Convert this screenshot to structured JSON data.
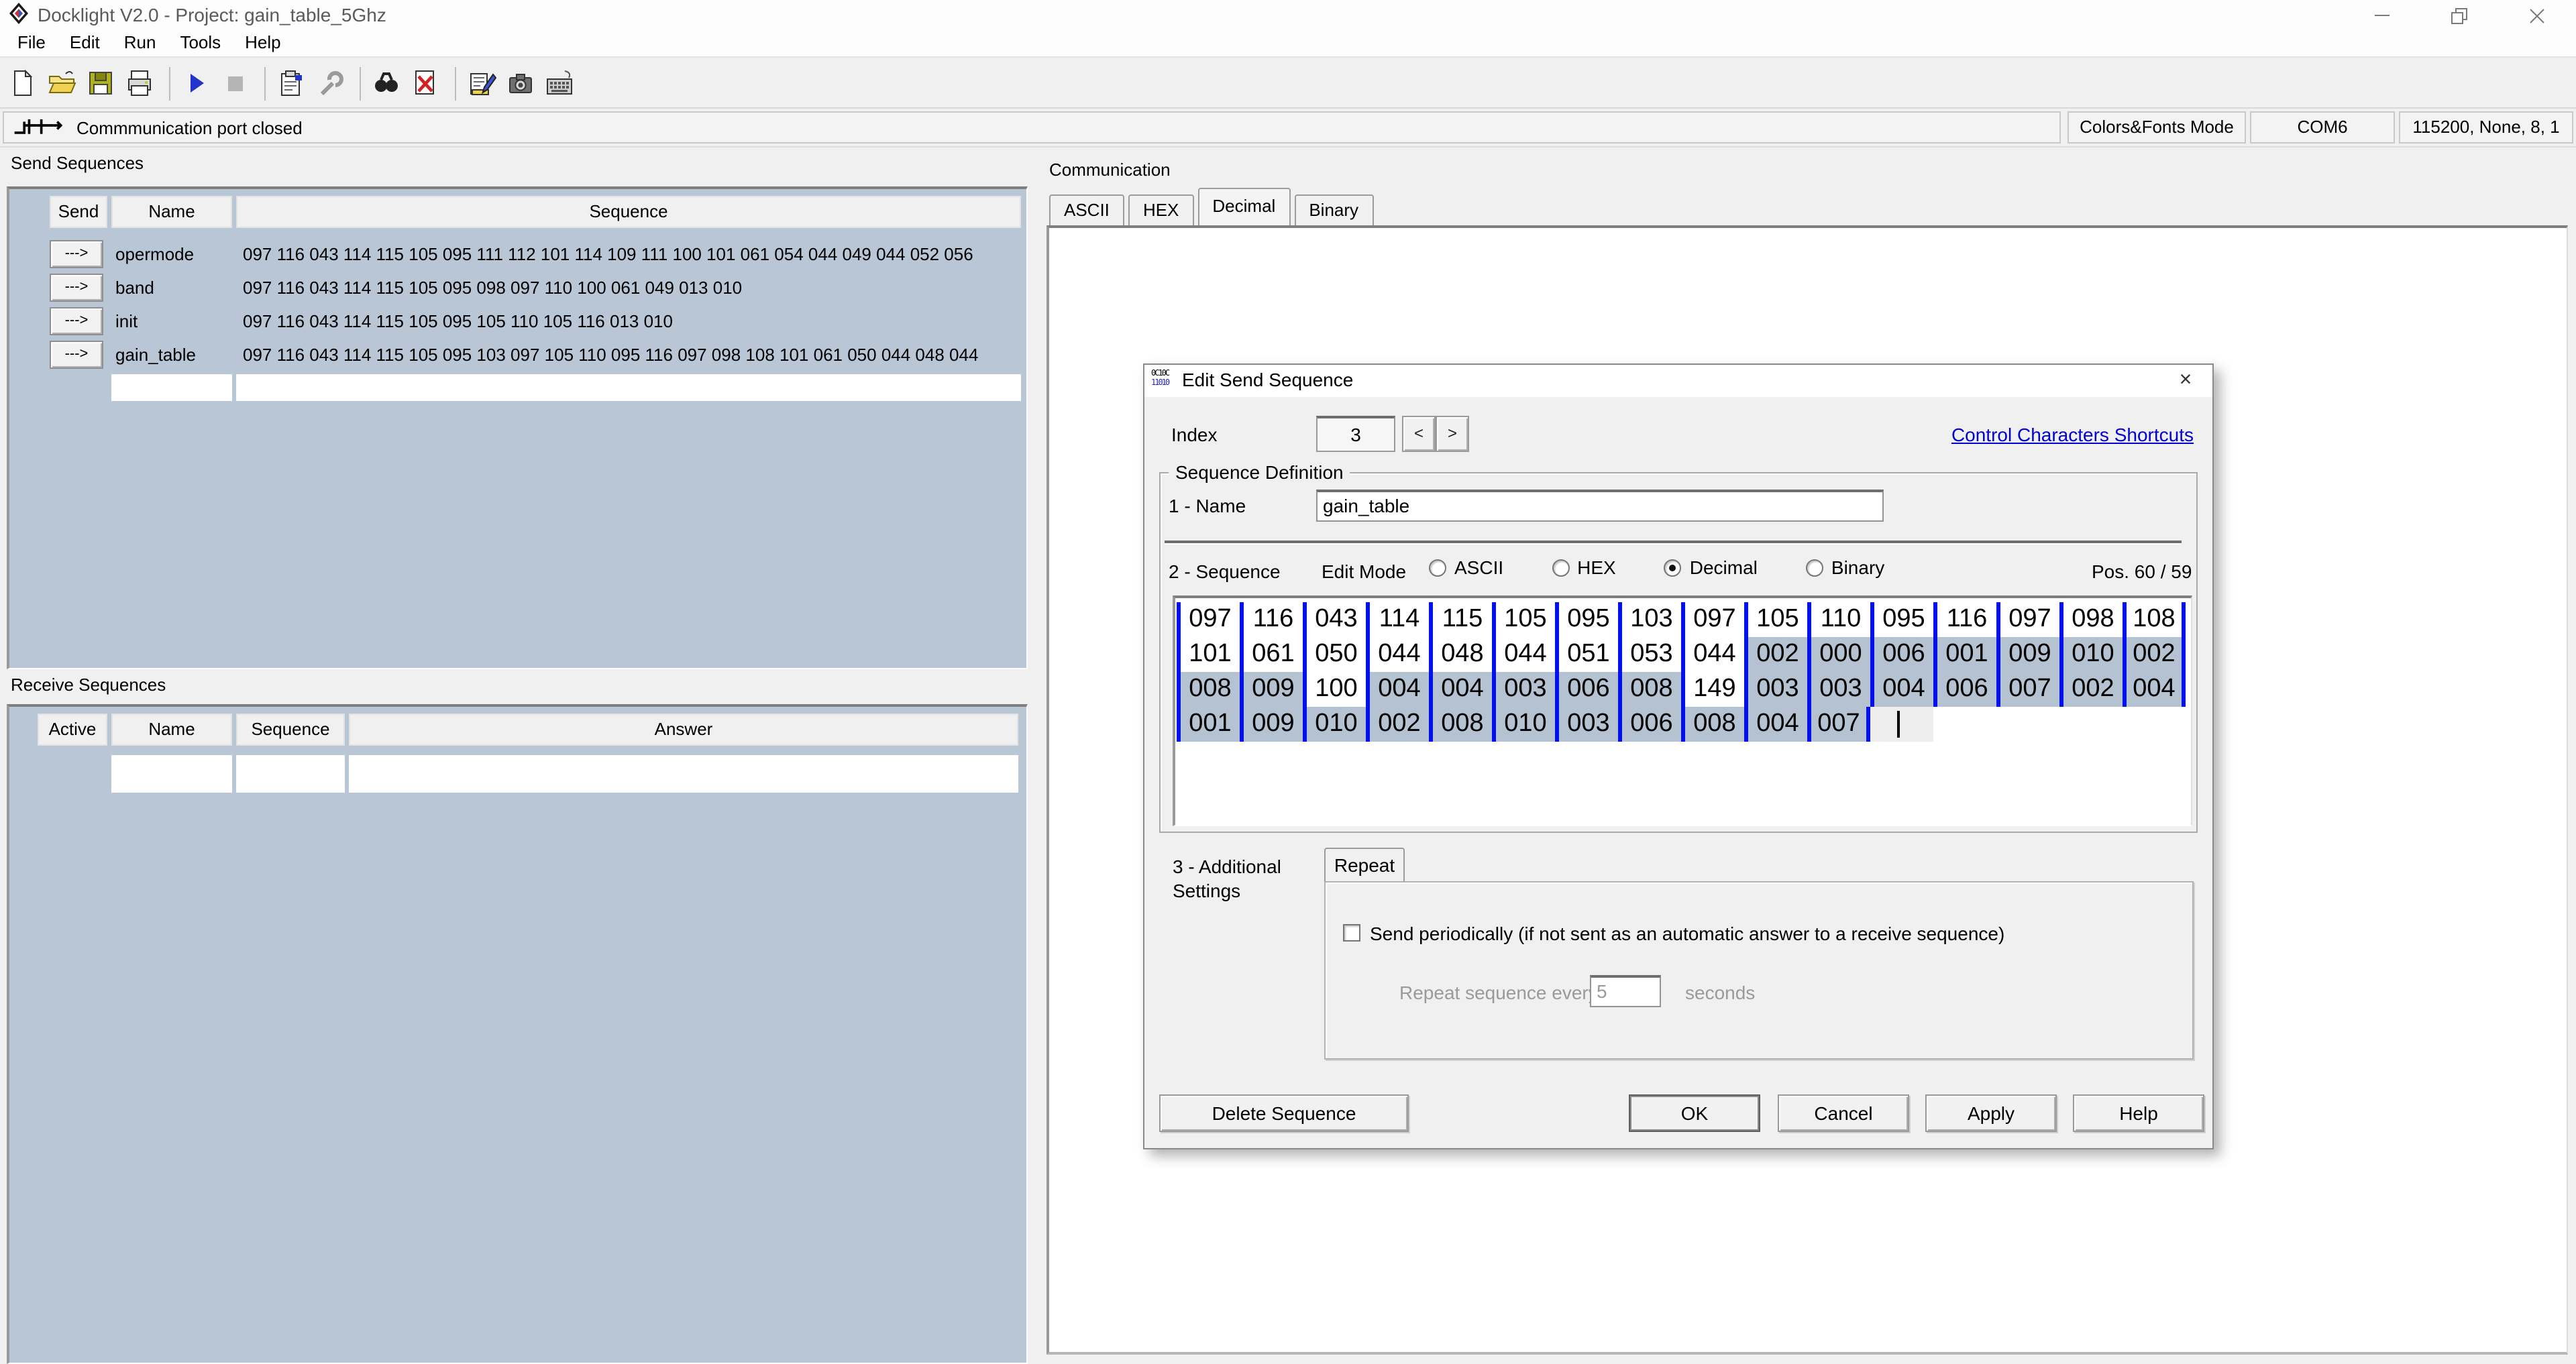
{
  "window": {
    "title": "Docklight V2.0 - Project: gain_table_5Ghz"
  },
  "menu": {
    "items": [
      "File",
      "Edit",
      "Run",
      "Tools",
      "Help"
    ]
  },
  "toolbar": {
    "groups": [
      [
        "new-file",
        "open-project",
        "save-project",
        "print"
      ],
      [
        "start-communication",
        "stop-communication"
      ],
      [
        "project-settings",
        "options-wrench"
      ],
      [
        "find",
        "clear-communication"
      ],
      [
        "edit-send-sequences",
        "snapshot-camera",
        "keyboard-console"
      ]
    ]
  },
  "status": {
    "message": "Commmunication port closed",
    "mode": "Colors&Fonts Mode",
    "port": "COM6",
    "params": "115200, None, 8, 1"
  },
  "send_sequences": {
    "title": "Send Sequences",
    "columns": [
      "Send",
      "Name",
      "Sequence"
    ],
    "send_button_label": "--->",
    "rows": [
      {
        "name": "opermode",
        "sequence": "097 116 043 114 115 105 095 111 112 101 114 109 111 100 101 061 054 044 049 044 052 056"
      },
      {
        "name": "band",
        "sequence": "097 116 043 114 115 105 095 098 097 110 100 061 049 013 010"
      },
      {
        "name": "init",
        "sequence": "097 116 043 114 115 105 095 105 110 105 116 013 010"
      },
      {
        "name": "gain_table",
        "sequence": "097 116 043 114 115 105 095 103 097 105 110 095 116 097 098 108 101 061 050 044 048 044"
      }
    ]
  },
  "receive_sequences": {
    "title": "Receive Sequences",
    "columns": [
      "Active",
      "Name",
      "Sequence",
      "Answer"
    ]
  },
  "communication": {
    "title": "Communication",
    "tabs": [
      "ASCII",
      "HEX",
      "Decimal",
      "Binary"
    ],
    "active_tab": "Decimal"
  },
  "dialog": {
    "title": "Edit Send Sequence",
    "close_glyph": "×",
    "index_label": "Index",
    "index_value": "3",
    "prev_label": "<",
    "next_label": ">",
    "link": "Control Characters Shortcuts",
    "group_title": "Sequence Definition",
    "name_label": "1 - Name",
    "name_value": "gain_table",
    "sequence_label": "2 - Sequence",
    "edit_mode_label": "Edit Mode",
    "edit_modes": [
      {
        "label": "ASCII",
        "selected": false
      },
      {
        "label": "HEX",
        "selected": false
      },
      {
        "label": "Decimal",
        "selected": true
      },
      {
        "label": "Binary",
        "selected": false
      }
    ],
    "pos_label": "Pos. 60 / 59",
    "grid": {
      "caret": true,
      "rows": [
        {
          "values": [
            "097",
            "116",
            "043",
            "114",
            "115",
            "105",
            "095",
            "103",
            "097",
            "105",
            "110",
            "095",
            "116",
            "097",
            "098",
            "108"
          ],
          "highlighted": [
            false,
            false,
            false,
            false,
            false,
            false,
            false,
            false,
            false,
            false,
            false,
            false,
            false,
            false,
            false,
            false
          ]
        },
        {
          "values": [
            "101",
            "061",
            "050",
            "044",
            "048",
            "044",
            "051",
            "053",
            "044",
            "002",
            "000",
            "006",
            "001",
            "009",
            "010",
            "002"
          ],
          "highlighted": [
            false,
            false,
            false,
            false,
            false,
            false,
            false,
            false,
            false,
            true,
            true,
            true,
            true,
            true,
            true,
            true
          ]
        },
        {
          "values": [
            "008",
            "009",
            "100",
            "004",
            "004",
            "003",
            "006",
            "008",
            "149",
            "003",
            "003",
            "004",
            "006",
            "007",
            "002",
            "004"
          ],
          "highlighted": [
            true,
            true,
            false,
            true,
            true,
            true,
            true,
            true,
            false,
            true,
            true,
            true,
            true,
            true,
            true,
            true
          ]
        },
        {
          "values": [
            "001",
            "009",
            "010",
            "002",
            "008",
            "010",
            "003",
            "006",
            "008",
            "004",
            "007"
          ],
          "highlighted": [
            true,
            true,
            true,
            true,
            true,
            true,
            true,
            true,
            true,
            true,
            true
          ]
        }
      ]
    },
    "additional_label_line1": "3 - Additional",
    "additional_label_line2": "Settings",
    "repeat_tab": "Repeat",
    "send_periodically": "Send periodically  (if not sent as an automatic answer to a receive sequence)",
    "repeat_every": "Repeat sequence every",
    "repeat_value": "5",
    "seconds_label": "seconds",
    "buttons": {
      "delete": "Delete Sequence",
      "ok": "OK",
      "cancel": "Cancel",
      "apply": "Apply",
      "help": "Help"
    }
  },
  "colors": {
    "panel_blue": "#b8c6d5",
    "grid_separator_blue": "#0011ee",
    "selection_highlight": "#b5c2d2",
    "link_blue": "#0000d4"
  }
}
